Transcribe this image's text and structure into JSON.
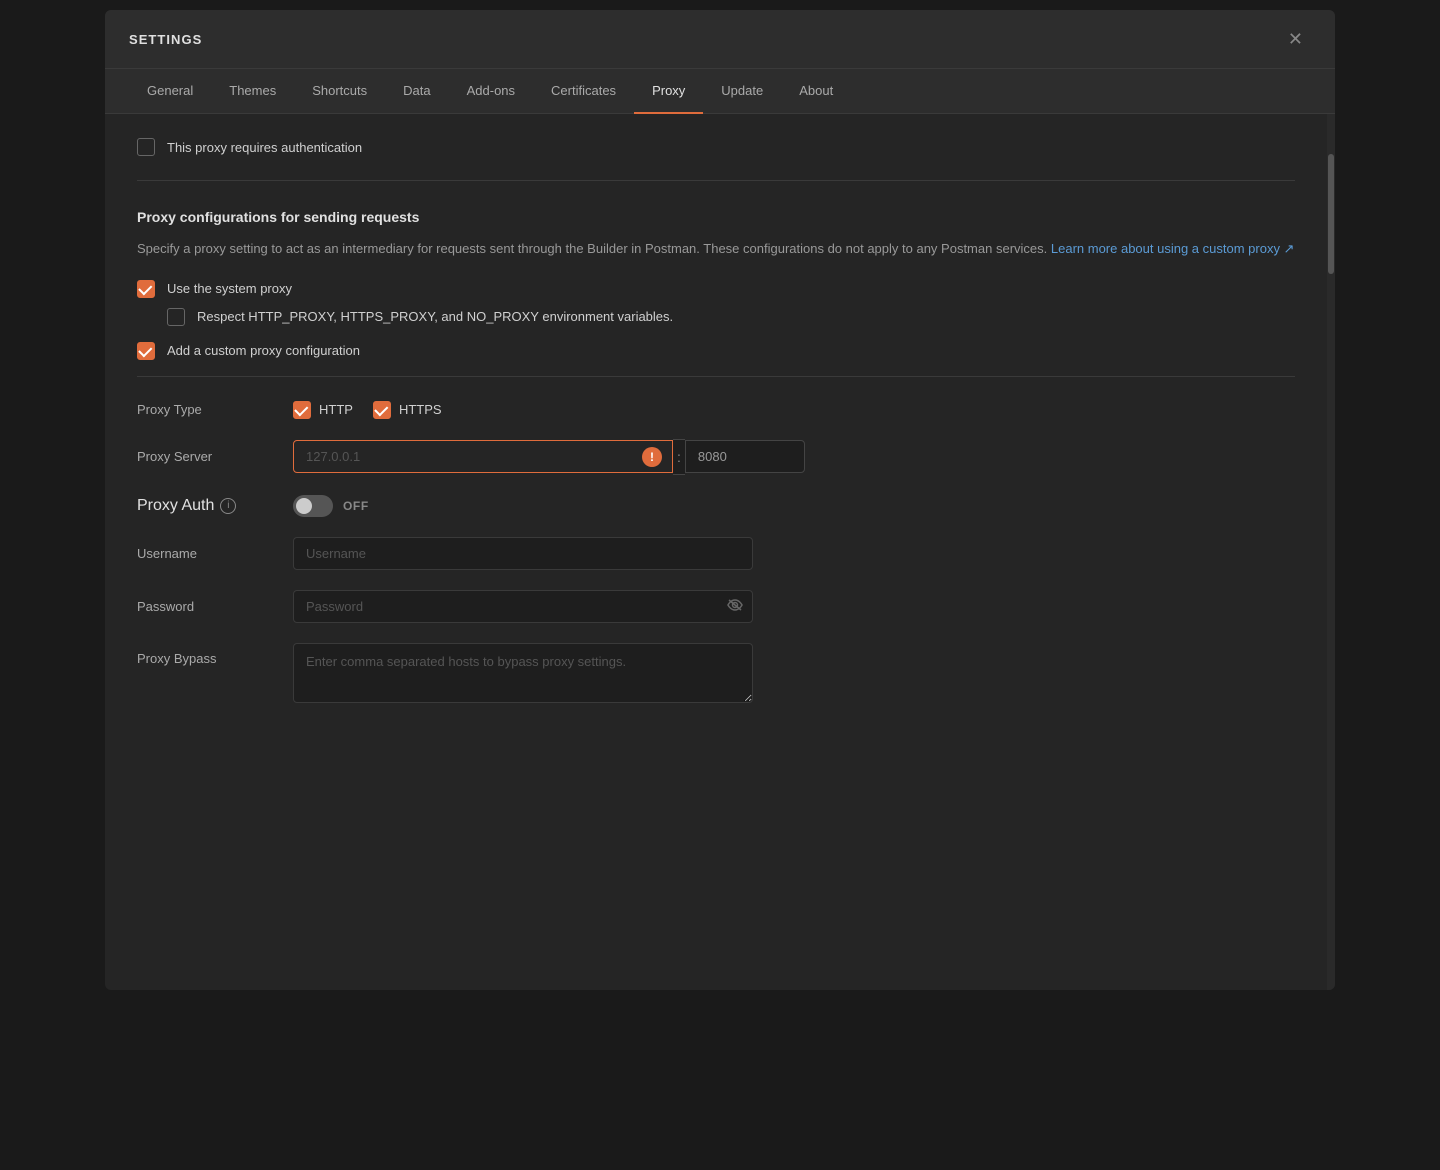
{
  "window": {
    "title": "SETTINGS",
    "close_label": "✕"
  },
  "tabs": [
    {
      "id": "general",
      "label": "General",
      "active": false
    },
    {
      "id": "themes",
      "label": "Themes",
      "active": false
    },
    {
      "id": "shortcuts",
      "label": "Shortcuts",
      "active": false
    },
    {
      "id": "data",
      "label": "Data",
      "active": false
    },
    {
      "id": "addons",
      "label": "Add-ons",
      "active": false
    },
    {
      "id": "certificates",
      "label": "Certificates",
      "active": false
    },
    {
      "id": "proxy",
      "label": "Proxy",
      "active": true
    },
    {
      "id": "update",
      "label": "Update",
      "active": false
    },
    {
      "id": "about",
      "label": "About",
      "active": false
    }
  ],
  "top_section": {
    "auth_checkbox": {
      "label": "This proxy requires authentication",
      "checked": false
    }
  },
  "proxy_configs": {
    "section_title": "Proxy configurations for sending requests",
    "description": "Specify a proxy setting to act as an intermediary for requests sent through the Builder in Postman. These configurations do not apply to any Postman services.",
    "learn_more_text": "Learn more about using a custom proxy ↗",
    "learn_more_href": "#",
    "use_system_proxy": {
      "label": "Use the system proxy",
      "checked": true
    },
    "respect_env_vars": {
      "label": "Respect HTTP_PROXY, HTTPS_PROXY, and NO_PROXY environment variables.",
      "checked": false
    },
    "custom_proxy": {
      "label": "Add a custom proxy configuration",
      "checked": true
    },
    "proxy_type": {
      "label": "Proxy Type",
      "http": {
        "label": "HTTP",
        "checked": true
      },
      "https": {
        "label": "HTTPS",
        "checked": true
      }
    },
    "proxy_server": {
      "label": "Proxy Server",
      "placeholder": "127.0.0.1",
      "port_value": "8080",
      "has_error": true
    },
    "proxy_auth": {
      "label": "Proxy Auth",
      "toggle_state": "off",
      "toggle_label": "OFF"
    },
    "username": {
      "label": "Username",
      "placeholder": "Username"
    },
    "password": {
      "label": "Password",
      "placeholder": "Password"
    },
    "bypass": {
      "placeholder": "Enter comma separated hosts to bypass proxy settings."
    }
  },
  "icons": {
    "close": "✕",
    "check": "✓",
    "error": "!",
    "eye_off": "👁",
    "info": "i",
    "external_link": "↗"
  }
}
